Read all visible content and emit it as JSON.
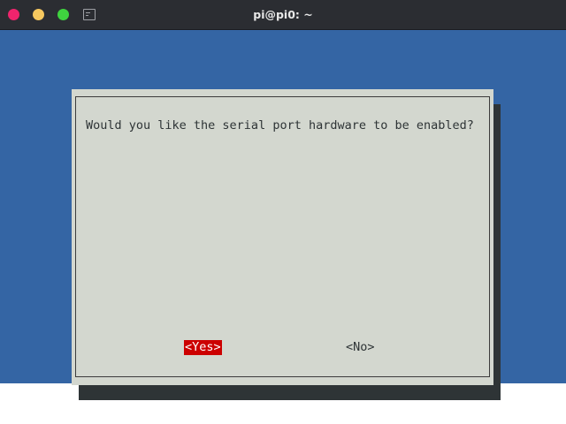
{
  "window": {
    "title": "pi@pi0: ~",
    "controls": {
      "close_color": "#f0246d",
      "minimize_color": "#f6c85f",
      "maximize_color": "#3fd33f"
    },
    "icon": "terminal-icon"
  },
  "dialog": {
    "message": "Would you like the serial port hardware to be enabled?",
    "buttons": {
      "yes_label": "<Yes>",
      "no_label": "<No>"
    },
    "selected": "yes"
  },
  "colors": {
    "terminal_background": "#3465a4",
    "dialog_background": "#d3d7cf",
    "dialog_shadow": "#2e3436",
    "selected_button": "#cc0000"
  }
}
